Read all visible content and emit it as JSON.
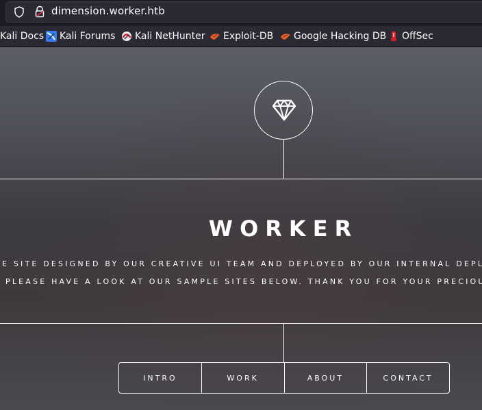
{
  "browser": {
    "url": "dimension.worker.htb"
  },
  "bookmarks": [
    {
      "label": "Kali Docs",
      "icon": "kali-docs-icon"
    },
    {
      "label": "Kali Forums",
      "icon": "kali-forums-icon"
    },
    {
      "label": "Kali NetHunter",
      "icon": "kali-nethunter-icon"
    },
    {
      "label": "Exploit-DB",
      "icon": "exploit-db-icon"
    },
    {
      "label": "Google Hacking DB",
      "icon": "google-hacking-db-icon"
    },
    {
      "label": "OffSec",
      "icon": "offsec-icon"
    }
  ],
  "page": {
    "logo_icon": "diamond-icon",
    "title": "WORKER",
    "description_line1": "E SITE DESIGNED BY OUR CREATIVE UI TEAM AND DEPLOYED BY OUR INTERNAL DEPLOYM",
    "description_line2": "PLEASE HAVE A LOOK AT OUR SAMPLE SITES BELOW. THANK YOU FOR YOUR PRECIOUS T",
    "nav": [
      "INTRO",
      "WORK",
      "ABOUT",
      "CONTACT"
    ]
  },
  "colors": {
    "chrome_bg": "#1c1b22",
    "toolbar_bg": "#2b2a33",
    "text": "#fbfbfe",
    "page_line": "#ffffff"
  }
}
